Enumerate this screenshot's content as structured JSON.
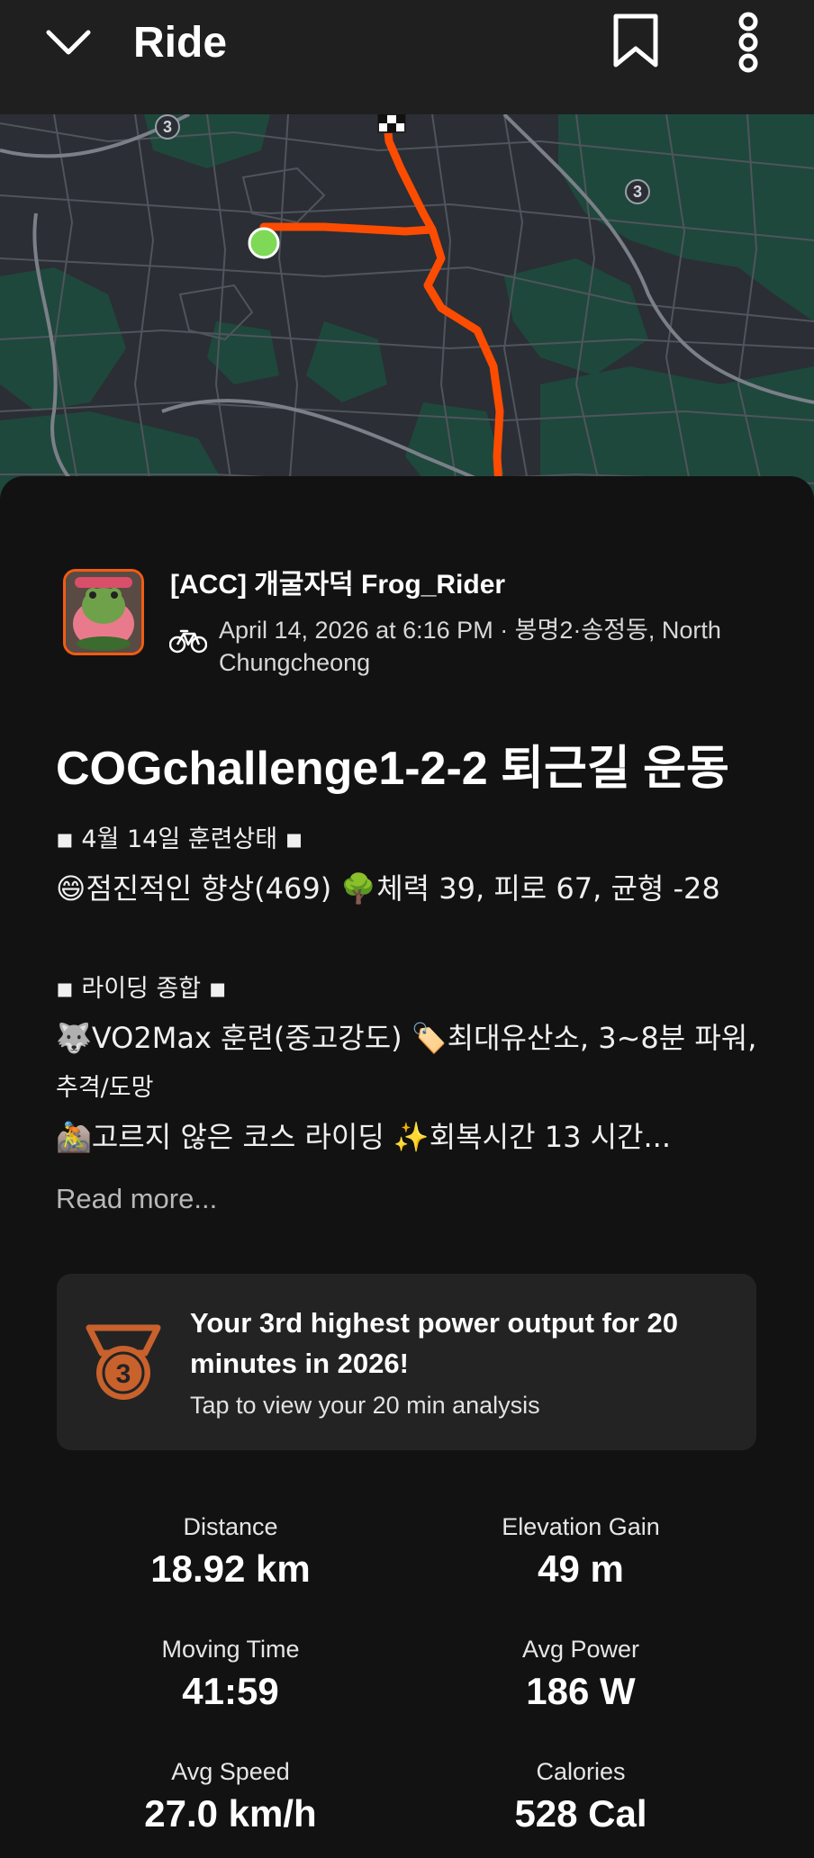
{
  "header": {
    "title": "Ride",
    "back_icon": "chevron-down-icon",
    "bookmark_icon": "bookmark-icon",
    "more_icon": "more-vertical-icon"
  },
  "map": {
    "route_color": "#fc4c02",
    "start_color": "#7ed957",
    "road_labels": [
      "3",
      "3"
    ]
  },
  "activity": {
    "athlete_name": "[ACC] 개굴자덕 Frog_Rider",
    "sport_icon": "bike-icon",
    "date_location": "April 14, 2026 at 6:16 PM · 봉명2·송정동, North Chungcheong",
    "title": "COGchallenge1-2-2 퇴근길 운동",
    "description_lines": [
      "◾ 4월 14일 훈련상태 ◾",
      "😄점진적인 향상(469) 🌳체력 39, 피로 67, 균형 -28",
      "",
      "◾ 라이딩 종합 ◾",
      "🐺VO2Max 훈련(중고강도) 🏷️최대유산소, 3~8분 파워,",
      "추격/도망",
      "🚵고르지 않은 코스 라이딩 ✨회복시간 13 시간..."
    ],
    "read_more": "Read more..."
  },
  "achievement": {
    "medal_icon": "medal-icon",
    "medal_rank": "3",
    "title": "Your 3rd highest power output for 20 minutes in 2026!",
    "subtitle": "Tap to view your 20 min analysis"
  },
  "stats": [
    {
      "label": "Distance",
      "value": "18.92 km"
    },
    {
      "label": "Elevation Gain",
      "value": "49 m"
    },
    {
      "label": "Moving Time",
      "value": "41:59"
    },
    {
      "label": "Avg Power",
      "value": "186 W"
    },
    {
      "label": "Avg Speed",
      "value": "27.0 km/h"
    },
    {
      "label": "Calories",
      "value": "528 Cal"
    }
  ],
  "colors": {
    "accent": "#fc4c02",
    "background": "#121212",
    "card": "#232323",
    "medal": "#c8612c"
  }
}
